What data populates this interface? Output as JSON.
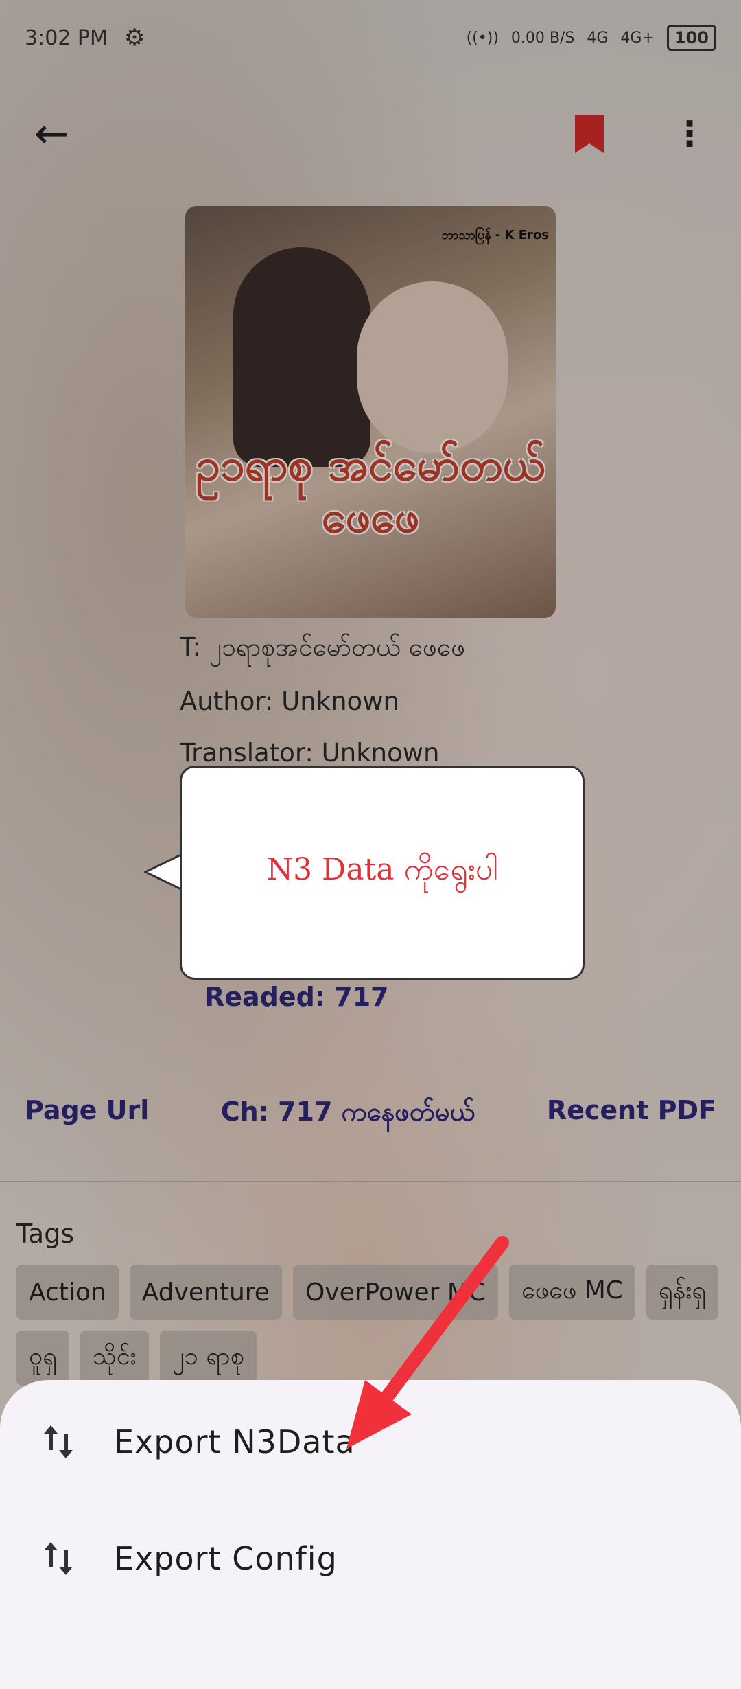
{
  "status": {
    "time": "3:02 PM",
    "data_rate": "0.00 B/S",
    "net1": "4G",
    "net2": "4G+",
    "battery": "100"
  },
  "book": {
    "cover_brand": "ဘာသာပြန် - K Eros",
    "cover_title": "ဥ၁ရာစု အင်မော်တယ် ဖေဖေ",
    "title_line": "T: ၂၁ရာစုအင်မော်တယ် ဖေဖေ",
    "author_line": "Author: Unknown",
    "translator_line": "Translator: Unknown",
    "readed": "Readed: 717"
  },
  "tooltip": {
    "text": "N3 Data ကိုရွေးပါ"
  },
  "links": {
    "page_url": "Page Url",
    "chapter": "Ch: 717 ကနေဖတ်မယ်",
    "recent_pdf": "Recent PDF"
  },
  "tags": {
    "label": "Tags",
    "items": [
      "Action",
      "Adventure",
      "OverPower MC",
      "ဖေဖေ MC",
      "ရှန်းရှ",
      "ဝူရှ",
      "သိုင်း",
      "၂၁ ရာစု"
    ]
  },
  "sheet": {
    "items": [
      {
        "label": "Export N3Data",
        "icon": "swap-vert-icon"
      },
      {
        "label": "Export Config",
        "icon": "swap-vert-icon"
      }
    ]
  },
  "colors": {
    "accent_link": "#2f2a7a",
    "bookmark": "#d62b2b",
    "tooltip_text": "#e0303a",
    "arrow": "#f0303a"
  }
}
